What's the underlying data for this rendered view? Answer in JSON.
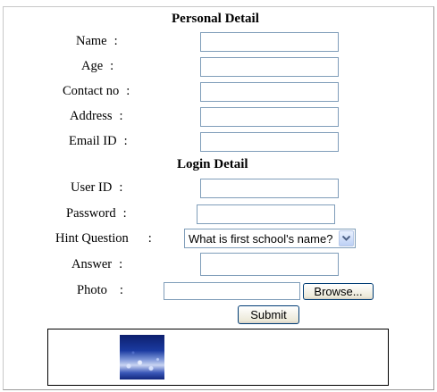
{
  "personal": {
    "heading": "Personal Detail",
    "name_label": "Name",
    "age_label": "Age",
    "contact_label": "Contact no",
    "address_label": "Address",
    "email_label": "Email ID",
    "name_value": "",
    "age_value": "",
    "contact_value": "",
    "address_value": "",
    "email_value": ""
  },
  "login": {
    "heading": "Login Detail",
    "userid_label": "User ID",
    "password_label": "Password",
    "hint_label": "Hint Question",
    "answer_label": "Answer",
    "photo_label": "Photo",
    "userid_value": "",
    "password_value": "",
    "hint_selected": "What is first school's name?",
    "answer_value": "",
    "photo_value": ""
  },
  "colon": ":",
  "buttons": {
    "browse": "Browse...",
    "submit": "Submit"
  },
  "icons": {
    "dropdown": "chevron-down-icon",
    "photo_preview": "photo-thumbnail"
  },
  "colors": {
    "input_border": "#7f9db9",
    "button_border": "#003c74"
  }
}
